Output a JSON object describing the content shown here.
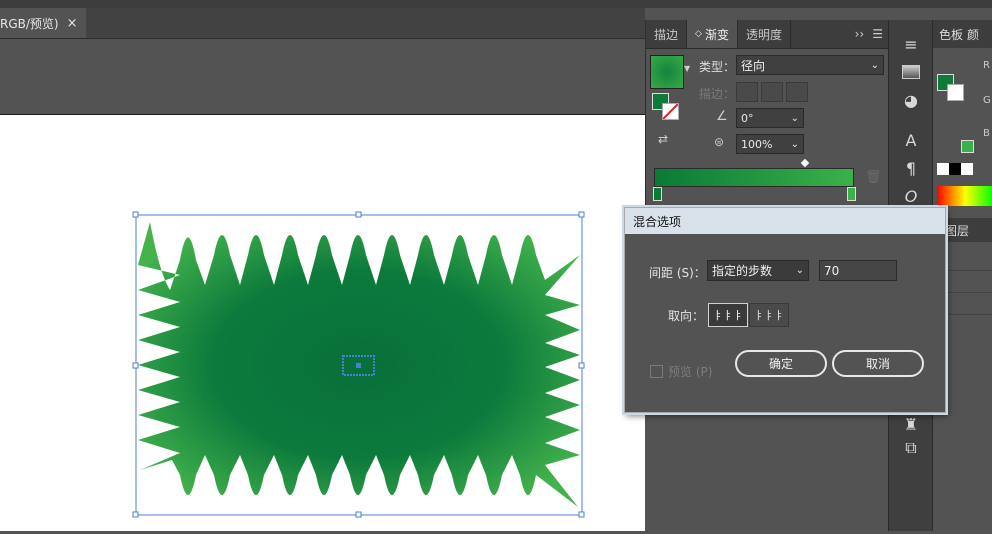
{
  "document": {
    "tab_title": "RGB/预览)",
    "close_glyph": "×"
  },
  "gradient_panel": {
    "tabs": [
      "描边",
      "渐变",
      "透明度"
    ],
    "active_tab": "渐变",
    "menu_glyph": "››",
    "type_label": "类型：",
    "type_value": "径向",
    "stroke_label": "描边：",
    "angle_value": "0°",
    "aspect_value": "100%",
    "gradient_start_color": "#0a7a37",
    "gradient_end_color": "#3cb04a"
  },
  "right_panels": {
    "swatches_tab": "色板",
    "color_tab_partial": "颜",
    "layers_tab": "图层",
    "rgb_labels": [
      "R",
      "G",
      "B"
    ]
  },
  "dialog": {
    "title": "混合选项",
    "spacing_label": "间距 (S)：",
    "spacing_value": "指定的步数",
    "steps_value": "70",
    "orientation_label": "取向：",
    "preview_label": "预览 (P)",
    "preview_checked": false,
    "ok_label": "确定",
    "cancel_label": "取消"
  },
  "artwork": {
    "fill_center": "#08703a",
    "fill_edge": "#41b04b",
    "selection_color": "#4a7fd6"
  },
  "icons": [
    "close-icon",
    "menu-icon",
    "chevron-down-icon",
    "swap-icon",
    "reverse-icon",
    "angle-icon",
    "aspect-icon",
    "trash-icon",
    "align-page-icon",
    "align-path-icon",
    "type-icon",
    "paragraph-icon",
    "opentype-icon",
    "layers-icon"
  ]
}
